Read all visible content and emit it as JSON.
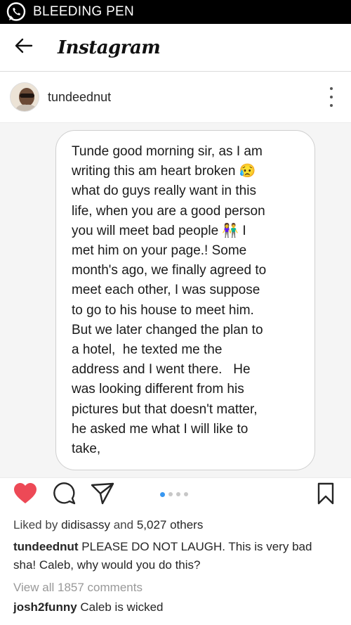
{
  "watermark": {
    "text": "BLEEDING PEN"
  },
  "header": {
    "logo_text": "Instagram"
  },
  "post": {
    "username": "tundeednut",
    "image_text": "Tunde good morning sir, as I am\nwriting this am heart broken 😥\nwhat do guys really want in this\nlife, when you are a good person\nyou will meet bad people 👫 I\nmet him on your page.! Some\nmonth's ago, we finally agreed to\nmeet each other, I was suppose\nto go to his house to meet him.\nBut we later changed the plan to\na hotel,  he texted me the\naddress and I went there.   He\nwas looking different from his\npictures but that doesn't matter,\nhe asked me what I will like to\ntake,",
    "carousel_pages": 4,
    "carousel_active": 1
  },
  "likes": {
    "prefix": "Liked by",
    "user": "didisassy",
    "and": "and",
    "count": "5,027 others"
  },
  "caption": {
    "username": "tundeednut",
    "text": "PLEASE DO NOT LAUGH. This is very bad sha! Caleb, why would you do this?"
  },
  "comments": {
    "view_all": "View all 1857 comments",
    "items": [
      {
        "username": "josh2funny",
        "text": "Caleb is wicked"
      }
    ]
  },
  "colors": {
    "like": "#ed4956",
    "accent": "#3897f0",
    "muted": "#999999"
  },
  "icons": [
    "whatsapp-icon",
    "back-arrow-icon",
    "more-vertical-icon",
    "heart-icon",
    "comment-icon",
    "share-icon",
    "bookmark-icon"
  ]
}
